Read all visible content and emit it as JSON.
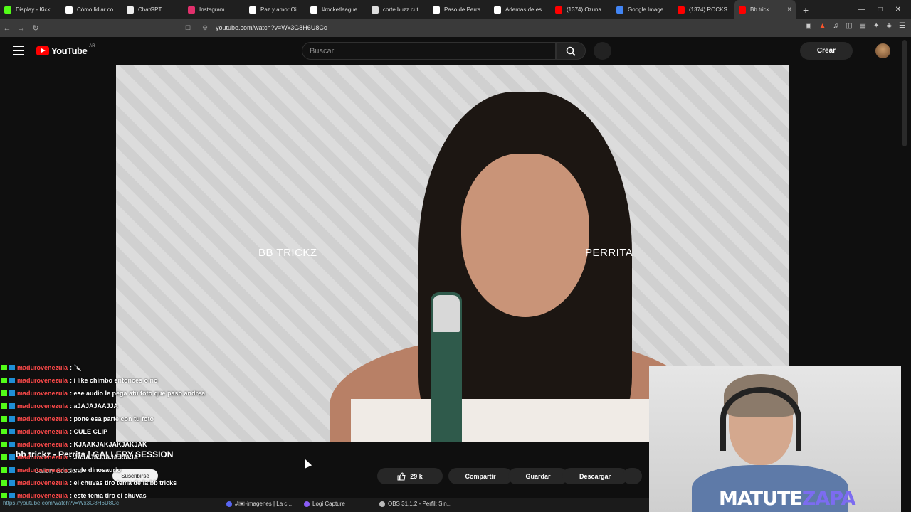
{
  "browser": {
    "tabs": [
      {
        "label": "Display - Kick",
        "color": "#53fc18"
      },
      {
        "label": "Cómo lidiar co",
        "color": "#ffffff"
      },
      {
        "label": "ChatGPT",
        "color": "#eeeeee"
      },
      {
        "label": "Instagram",
        "color": "#e1306c"
      },
      {
        "label": "Paz y amor Oi",
        "color": "#ffffff"
      },
      {
        "label": "#rocketleague",
        "color": "#ffffff"
      },
      {
        "label": "corte buzz cut",
        "color": "#dddddd"
      },
      {
        "label": "Paso de Perra",
        "color": "#ffffff"
      },
      {
        "label": "Ademas de es",
        "color": "#ffffff"
      },
      {
        "label": "(1374) Ozuna",
        "color": "#ff0000"
      },
      {
        "label": "Google Image",
        "color": "#4285f4"
      },
      {
        "label": "(1374) ROCKS",
        "color": "#ff0000"
      },
      {
        "label": "Bb trick",
        "color": "#ff0000",
        "active": true
      }
    ],
    "new_tab": "+",
    "url": "youtube.com/watch?v=Wx3G8H6U8Cc"
  },
  "youtube": {
    "logo_text": "YouTube",
    "region": "AR",
    "search_placeholder": "Buscar",
    "create_label": "Crear"
  },
  "video": {
    "left_label": "BB TRICKZ",
    "right_label": "PERRITA",
    "title": "bb trickz - Perrita | GALLERY SESSION",
    "channel": "Gallery Sessions",
    "subscribe": "Suscribirse",
    "likes": "29 k",
    "share": "Compartir",
    "save": "Guardar",
    "download": "Descargar"
  },
  "chat": [
    {
      "user": "madurovenezula",
      "msg": ": 🔪"
    },
    {
      "user": "madurovenezula",
      "msg": ": i like chimbo entonces o no"
    },
    {
      "user": "madurovenezula",
      "msg": ": ese audio le pega atu foto que paso andrea"
    },
    {
      "user": "madurovenezula",
      "msg": ": aJAJAJAAJJA"
    },
    {
      "user": "madurovenezula",
      "msg": ": pone esa parte con tu foto"
    },
    {
      "user": "madurovenezula",
      "msg": ": CULE CLIP"
    },
    {
      "user": "madurovenezula",
      "msg": ": KJAAKJAKJAKJAKJAK"
    },
    {
      "user": "madurovenezula",
      "msg": ": JAJAJAJJAJAJJAJA"
    },
    {
      "user": "madurovenezula",
      "msg": ": cule dinosaurio"
    },
    {
      "user": "madurovenezula",
      "msg": ": el chuvas tiro tema de la bb tricks"
    },
    {
      "user": "madurovenezula",
      "msg": ": este tema tiro el chuvas"
    }
  ],
  "webcam": {
    "brand_a": "MATUTE",
    "brand_b": "ZAPA"
  },
  "taskbar": {
    "url_tip": "https://youtube.com/watch?v=Wx3G8H6U8Cc",
    "items": [
      {
        "label": "#📼-imagenes | La c...",
        "color": "#5865f2"
      },
      {
        "label": "Logi Capture",
        "color": "#8a5cf6"
      },
      {
        "label": "OBS 31.1.2 - Perfil: Sin...",
        "color": "#bbbbbb"
      }
    ]
  }
}
